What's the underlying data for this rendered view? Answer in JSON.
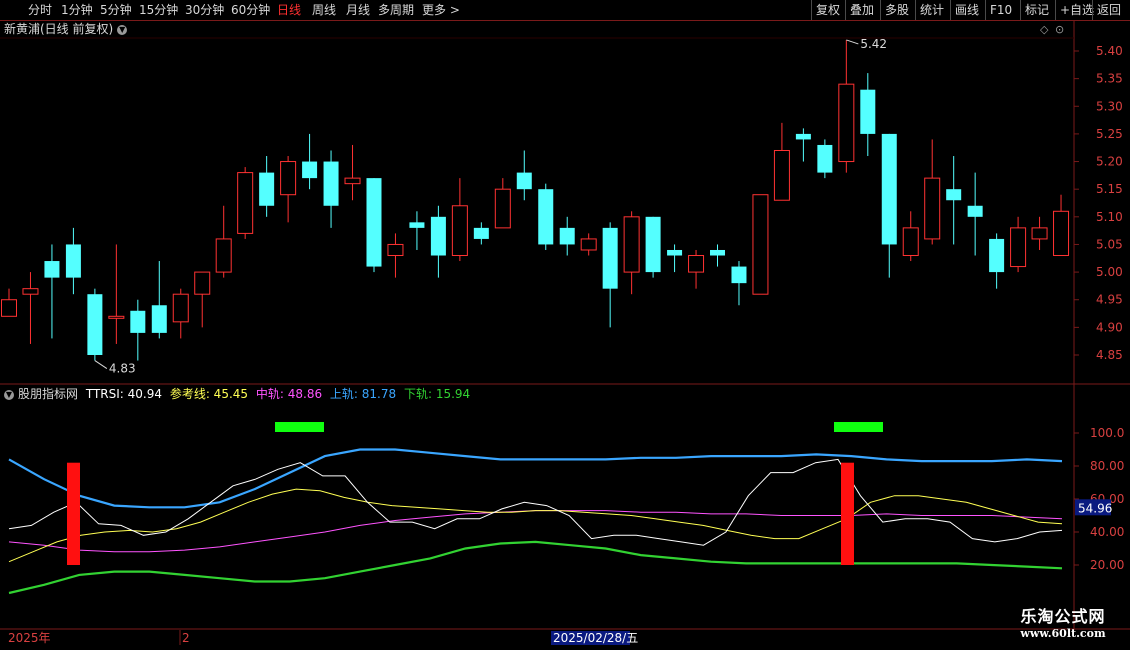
{
  "toolbar": {
    "periods": [
      "分时",
      "1分钟",
      "5分钟",
      "15分钟",
      "30分钟",
      "60分钟",
      "日线",
      "周线",
      "月线",
      "多周期",
      "更多 >"
    ],
    "active_period": "日线",
    "right_buttons": [
      "复权",
      "叠加",
      "多股",
      "统计",
      "画线",
      "F10",
      "标记",
      "+自选",
      "返回"
    ]
  },
  "main_chart": {
    "title": "新黄浦(日线 前复权)",
    "dot_icon": "chevron-down-icon",
    "high_label": "5.42",
    "low_label": "4.83",
    "price_ticks": [
      "5.40",
      "5.35",
      "5.30",
      "5.25",
      "5.20",
      "5.15",
      "5.10",
      "5.05",
      "5.00",
      "4.95",
      "4.90",
      "4.85"
    ],
    "candles": [
      [
        4.92,
        4.95,
        4.97,
        4.92
      ],
      [
        4.96,
        4.97,
        5.0,
        4.87
      ],
      [
        5.02,
        4.99,
        5.05,
        4.88
      ],
      [
        5.05,
        4.99,
        5.08,
        4.96
      ],
      [
        4.96,
        4.85,
        4.97,
        4.84
      ],
      [
        4.92,
        4.92,
        5.05,
        4.87
      ],
      [
        4.93,
        4.89,
        4.95,
        4.84
      ],
      [
        4.94,
        4.89,
        5.02,
        4.88
      ],
      [
        4.91,
        4.96,
        4.97,
        4.88
      ],
      [
        4.96,
        5.0,
        5.0,
        4.9
      ],
      [
        5.0,
        5.06,
        5.12,
        4.99
      ],
      [
        5.07,
        5.18,
        5.19,
        5.06
      ],
      [
        5.18,
        5.12,
        5.21,
        5.1
      ],
      [
        5.14,
        5.2,
        5.21,
        5.09
      ],
      [
        5.2,
        5.17,
        5.25,
        5.15
      ],
      [
        5.2,
        5.12,
        5.22,
        5.08
      ],
      [
        5.16,
        5.17,
        5.23,
        5.13
      ],
      [
        5.17,
        5.01,
        5.17,
        5.0
      ],
      [
        5.03,
        5.05,
        5.07,
        4.99
      ],
      [
        5.09,
        5.08,
        5.11,
        5.04
      ],
      [
        5.1,
        5.03,
        5.12,
        4.99
      ],
      [
        5.03,
        5.12,
        5.17,
        5.02
      ],
      [
        5.08,
        5.06,
        5.09,
        5.05
      ],
      [
        5.08,
        5.15,
        5.17,
        5.08
      ],
      [
        5.18,
        5.15,
        5.22,
        5.13
      ],
      [
        5.15,
        5.05,
        5.16,
        5.04
      ],
      [
        5.08,
        5.05,
        5.1,
        5.03
      ],
      [
        5.04,
        5.06,
        5.07,
        5.03
      ],
      [
        5.08,
        4.97,
        5.09,
        4.9
      ],
      [
        5.0,
        5.1,
        5.11,
        4.96
      ],
      [
        5.1,
        5.0,
        5.1,
        4.99
      ],
      [
        5.04,
        5.03,
        5.05,
        5.0
      ],
      [
        5.0,
        5.03,
        5.04,
        4.97
      ],
      [
        5.04,
        5.03,
        5.05,
        5.01
      ],
      [
        5.01,
        4.98,
        5.02,
        4.94
      ],
      [
        4.96,
        5.14,
        5.14,
        4.96
      ],
      [
        5.13,
        5.22,
        5.27,
        5.13
      ],
      [
        5.25,
        5.24,
        5.26,
        5.2
      ],
      [
        5.23,
        5.18,
        5.24,
        5.17
      ],
      [
        5.2,
        5.34,
        5.42,
        5.18
      ],
      [
        5.33,
        5.25,
        5.36,
        5.21
      ],
      [
        5.25,
        5.05,
        5.25,
        4.99
      ],
      [
        5.03,
        5.08,
        5.11,
        5.02
      ],
      [
        5.06,
        5.17,
        5.24,
        5.05
      ],
      [
        5.15,
        5.13,
        5.21,
        5.05
      ],
      [
        5.12,
        5.1,
        5.18,
        5.03
      ],
      [
        5.06,
        5.0,
        5.07,
        4.97
      ],
      [
        5.01,
        5.08,
        5.1,
        5.0
      ],
      [
        5.06,
        5.08,
        5.1,
        5.04
      ],
      [
        5.03,
        5.11,
        5.14,
        5.03
      ]
    ]
  },
  "indicator": {
    "name": "股朋指标网",
    "ttrsi_label": "TTRSI: 40.94",
    "ref_label": "参考线: 45.45",
    "mid_label": "中轨: 48.86",
    "upper_label": "上轨: 81.78",
    "lower_label": "下轨: 15.94",
    "ticks": [
      "100.0",
      "80.00",
      "60.00",
      "40.00",
      "20.00"
    ],
    "current_value_label": "54.96",
    "ttrsi": [
      42,
      44,
      52,
      58,
      45,
      44,
      38,
      40,
      48,
      58,
      68,
      72,
      78,
      82,
      74,
      74,
      58,
      46,
      46,
      42,
      48,
      48,
      54,
      58,
      56,
      50,
      36,
      38,
      38,
      36,
      34,
      32,
      40,
      62,
      76,
      76,
      82,
      84,
      62,
      46,
      48,
      48,
      46,
      36,
      34,
      36,
      40,
      41
    ],
    "ref": [
      22,
      28,
      34,
      38,
      40,
      41,
      40,
      42,
      46,
      52,
      58,
      63,
      66,
      65,
      61,
      58,
      56,
      55,
      54,
      53,
      52,
      52,
      53,
      53,
      52,
      51,
      50,
      48,
      46,
      44,
      41,
      38,
      36,
      36,
      42,
      48,
      58,
      62,
      62,
      60,
      58,
      54,
      50,
      46,
      45
    ],
    "mid": [
      34,
      32,
      29,
      28,
      28,
      29,
      31,
      34,
      37,
      40,
      44,
      47,
      49,
      51,
      52,
      53,
      53,
      53,
      52,
      52,
      51,
      51,
      50,
      50,
      50,
      51,
      50,
      50,
      50,
      49,
      48
    ],
    "upper": [
      84,
      72,
      62,
      56,
      55,
      55,
      58,
      66,
      76,
      86,
      90,
      90,
      88,
      86,
      84,
      84,
      84,
      84,
      85,
      85,
      86,
      86,
      86,
      87,
      86,
      84,
      83,
      83,
      83,
      84,
      83
    ],
    "lower": [
      3,
      8,
      14,
      16,
      16,
      14,
      12,
      10,
      10,
      12,
      16,
      20,
      24,
      30,
      33,
      34,
      32,
      30,
      26,
      24,
      22,
      21,
      21,
      21,
      21,
      21,
      21,
      21,
      20,
      19,
      18
    ]
  },
  "bottom_axis": {
    "year_label": "2025年",
    "mark_label": "2",
    "date_label": "2025/02/28/五"
  },
  "watermark": {
    "line1": "乐淘公式网",
    "line2": "www.60lt.com"
  },
  "colors": {
    "up": "#ff3232",
    "down": "#54ffff",
    "border": "#7a1a1a",
    "ttrsi": "#ffffff",
    "ref": "#ffff54",
    "mid": "#ff54ff",
    "upper": "#3aa6ff",
    "lower": "#32d232",
    "active_period": "#ff3030"
  }
}
